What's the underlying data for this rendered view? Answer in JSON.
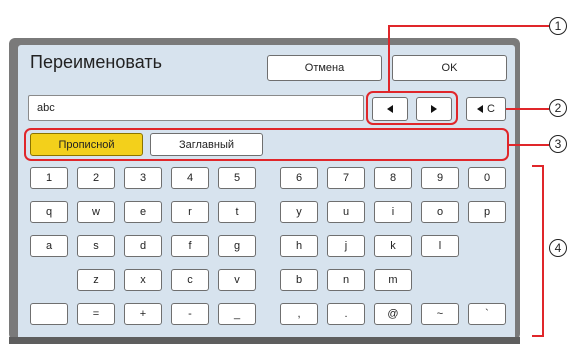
{
  "dialog": {
    "title": "Переименовать",
    "cancel_label": "Отмена",
    "ok_label": "OK"
  },
  "name_field": {
    "value": "abc"
  },
  "cursor": {
    "left_icon": "arrow-left-icon",
    "right_icon": "arrow-right-icon"
  },
  "clear_button": {
    "icon": "backspace-icon",
    "label": "C"
  },
  "case": {
    "lower_label": "Прописной",
    "upper_label": "Заглавный",
    "selected": "lower"
  },
  "keyboard": {
    "row1": [
      "1",
      "2",
      "3",
      "4",
      "5",
      "6",
      "7",
      "8",
      "9",
      "0"
    ],
    "row2": [
      "q",
      "w",
      "e",
      "r",
      "t",
      "y",
      "u",
      "i",
      "o",
      "p"
    ],
    "row3": [
      "a",
      "s",
      "d",
      "f",
      "g",
      "h",
      "j",
      "k",
      "l"
    ],
    "row4": [
      "z",
      "x",
      "c",
      "v",
      "b",
      "n",
      "m"
    ],
    "row5": [
      "",
      "=",
      "+",
      "-",
      "_",
      ",",
      ".",
      "@",
      "~",
      "`"
    ]
  },
  "callouts": [
    "1",
    "2",
    "3",
    "4"
  ],
  "colors": {
    "screen_bg": "#d7e3ee",
    "selected_case": "#f3d01b",
    "callout_red": "#e0262a"
  }
}
